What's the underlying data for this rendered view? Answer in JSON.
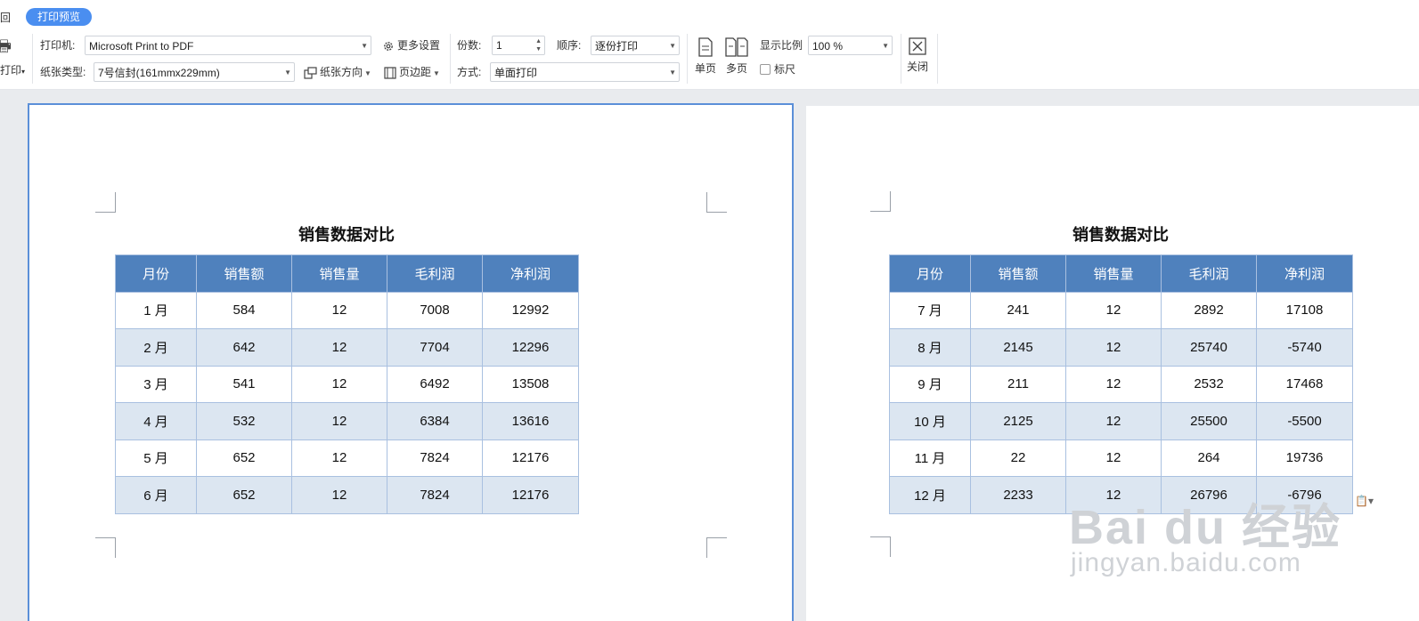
{
  "toolbar": {
    "back_label": "回",
    "tab_label": "打印预览",
    "print_label": "打印",
    "printer_label": "打印机:",
    "printer_value": "Microsoft Print to PDF",
    "more_settings": "更多设置",
    "paper_type_label": "纸张类型:",
    "paper_type_value": "7号信封(161mmx229mm)",
    "paper_orientation": "纸张方向",
    "margins": "页边距",
    "copies_label": "份数:",
    "copies_value": "1",
    "order_label": "顺序:",
    "order_value": "逐份打印",
    "mode_label": "方式:",
    "mode_value": "单面打印",
    "single_page": "单页",
    "multi_page": "多页",
    "zoom_label": "显示比例",
    "zoom_value": "100 %",
    "ruler_label": "标尺",
    "close_label": "关闭"
  },
  "pages": [
    {
      "title": "销售数据对比",
      "headers": [
        "月份",
        "销售额",
        "销售量",
        "毛利润",
        "净利润"
      ],
      "rows": [
        [
          "1 月",
          "584",
          "12",
          "7008",
          "12992"
        ],
        [
          "2 月",
          "642",
          "12",
          "7704",
          "12296"
        ],
        [
          "3 月",
          "541",
          "12",
          "6492",
          "13508"
        ],
        [
          "4 月",
          "532",
          "12",
          "6384",
          "13616"
        ],
        [
          "5 月",
          "652",
          "12",
          "7824",
          "12176"
        ],
        [
          "6 月",
          "652",
          "12",
          "7824",
          "12176"
        ]
      ]
    },
    {
      "title": "销售数据对比",
      "headers": [
        "月份",
        "销售额",
        "销售量",
        "毛利润",
        "净利润"
      ],
      "rows": [
        [
          "7 月",
          "241",
          "12",
          "2892",
          "17108"
        ],
        [
          "8 月",
          "2145",
          "12",
          "25740",
          "-5740"
        ],
        [
          "9 月",
          "211",
          "12",
          "2532",
          "17468"
        ],
        [
          "10 月",
          "2125",
          "12",
          "25500",
          "-5500"
        ],
        [
          "11 月",
          "22",
          "12",
          "264",
          "19736"
        ],
        [
          "12 月",
          "2233",
          "12",
          "26796",
          "-6796"
        ]
      ]
    }
  ],
  "watermark": {
    "main": "Bai du 经验",
    "sub": "jingyan.baidu.com"
  },
  "colors": {
    "accent": "#4a8ef0",
    "table_header": "#4f81bd",
    "table_alt_row": "#dce6f1",
    "page_selected_border": "#5b8fd8"
  }
}
